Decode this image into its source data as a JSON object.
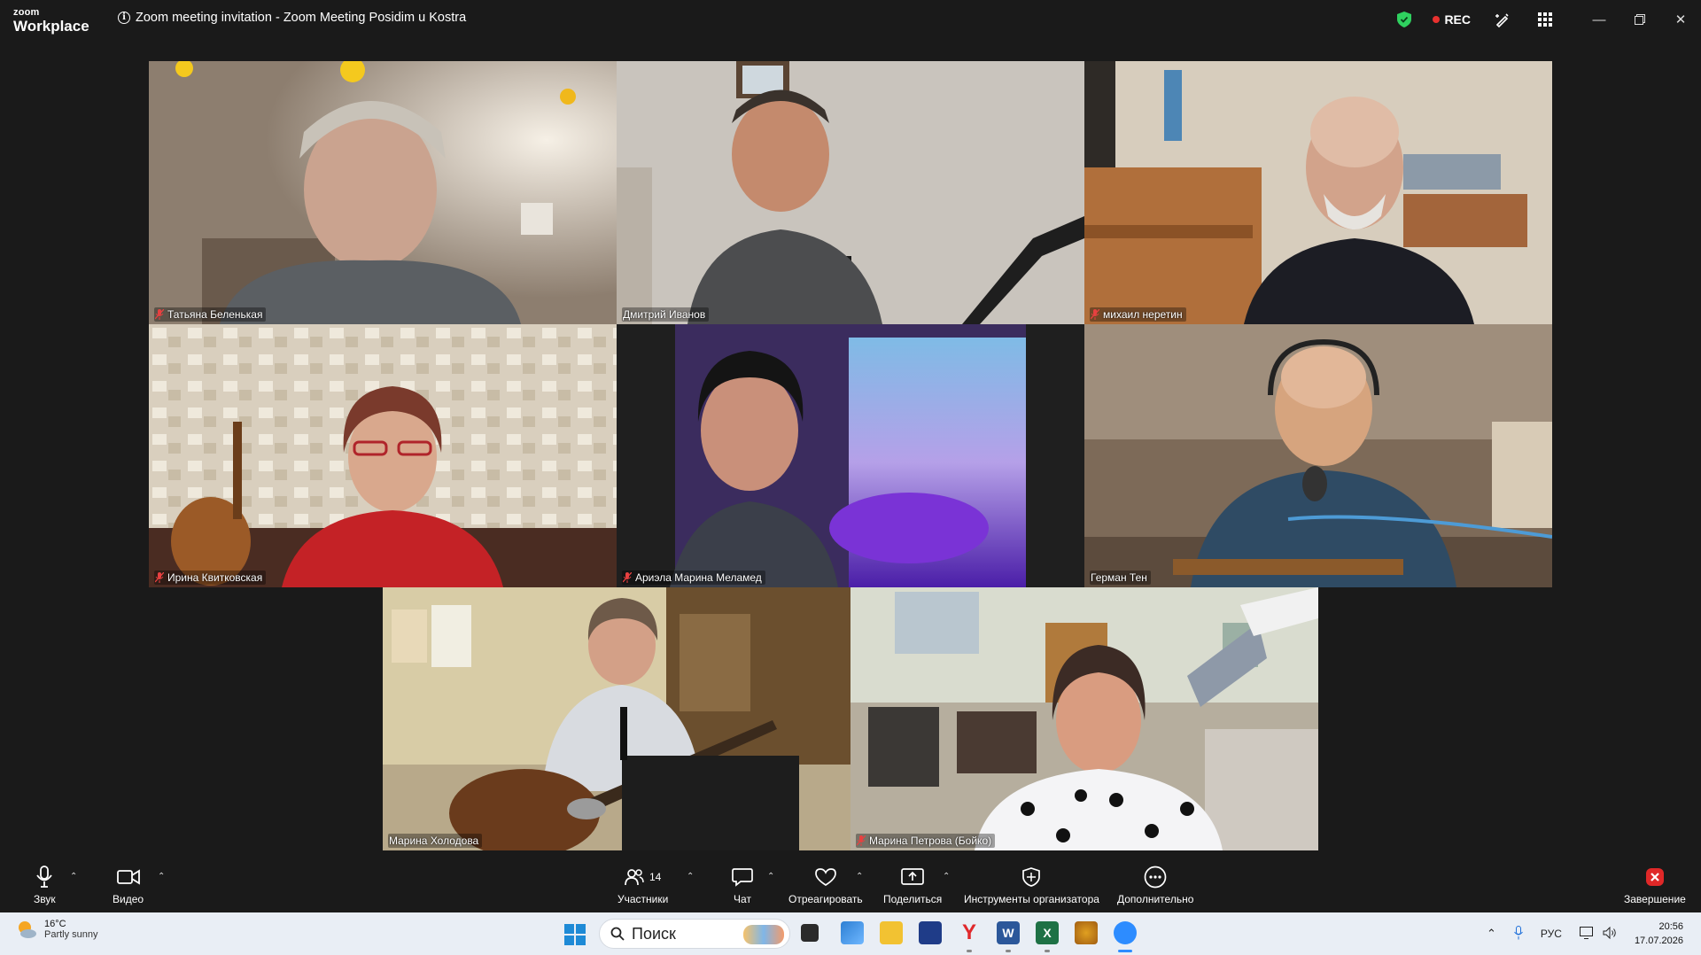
{
  "app": {
    "logo_line1": "zoom",
    "logo_line2": "Workplace",
    "title": "Zoom meeting invitation - Zoom Meeting Posidim u Kostra",
    "rec_label": "REC"
  },
  "participants": [
    {
      "name": "Татьяна Беленькая",
      "muted": true
    },
    {
      "name": "Дмитрий Иванов",
      "muted": false
    },
    {
      "name": "михаил неретин",
      "muted": true
    },
    {
      "name": "Ирина Квитковская",
      "muted": true
    },
    {
      "name": "Ариэла Марина Меламед",
      "muted": true
    },
    {
      "name": "Герман Тен",
      "muted": false,
      "active_speaker": true
    },
    {
      "name": "Марина Холодова",
      "muted": false
    },
    {
      "name": "Марина Петрова (Бойко)",
      "muted": true
    }
  ],
  "toolbar": {
    "audio_label": "Звук",
    "video_label": "Видео",
    "participants_label": "Участники",
    "participants_count": "14",
    "chat_label": "Чат",
    "react_label": "Отреагировать",
    "share_label": "Поделиться",
    "host_tools_label": "Инструменты организатора",
    "more_label": "Дополнительно",
    "end_label": "Завершение"
  },
  "taskbar": {
    "temperature": "16°C",
    "weather": "Partly sunny",
    "search_placeholder": "Поиск",
    "language": "РУС",
    "time": "20:56",
    "date": "17.07.2026"
  },
  "colors": {
    "active_speaker_border": "#2ecc71",
    "rec_dot": "#e8312f",
    "end_button": "#e02828",
    "security_shield": "#2fd15f"
  }
}
